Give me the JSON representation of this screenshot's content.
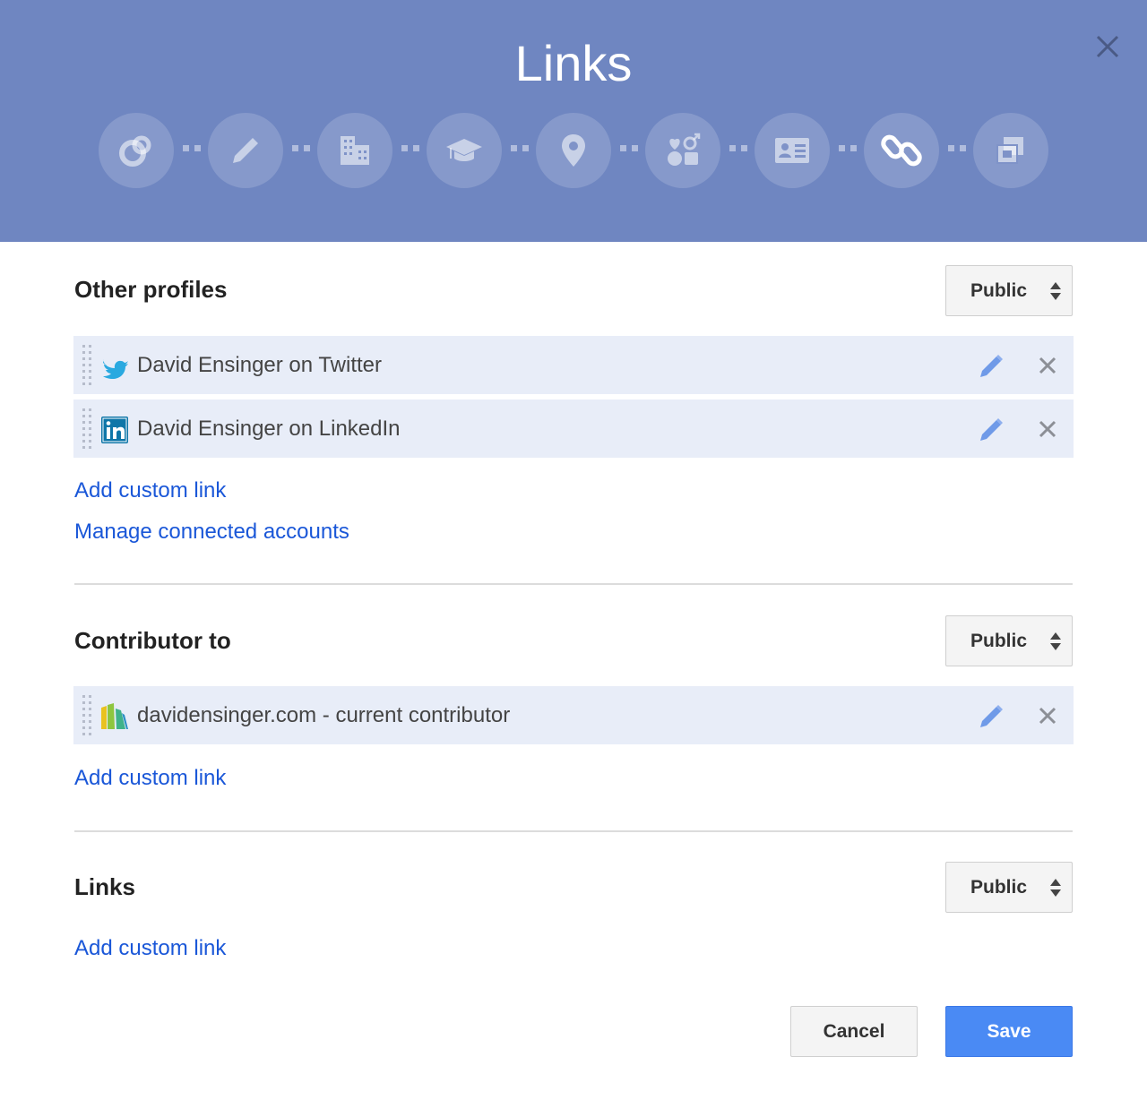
{
  "dialog": {
    "title": "Links",
    "close_icon": "close-icon",
    "steps": [
      {
        "name": "profile-step",
        "icon": "google-plus-ring-icon",
        "active": false
      },
      {
        "name": "about-step",
        "icon": "pencil-icon",
        "active": false
      },
      {
        "name": "work-step",
        "icon": "building-icon",
        "active": false
      },
      {
        "name": "education-step",
        "icon": "graduation-cap-icon",
        "active": false
      },
      {
        "name": "places-step",
        "icon": "map-pin-icon",
        "active": false
      },
      {
        "name": "basic-info-step",
        "icon": "gender-shapes-icon",
        "active": false
      },
      {
        "name": "contact-step",
        "icon": "contact-card-icon",
        "active": false
      },
      {
        "name": "links-step",
        "icon": "chain-link-icon",
        "active": true
      },
      {
        "name": "more-step",
        "icon": "stacked-windows-icon",
        "active": false
      }
    ]
  },
  "other_profiles": {
    "title": "Other profiles",
    "visibility": "Public",
    "items": [
      {
        "label": "David Ensinger on Twitter",
        "icon": "twitter-icon"
      },
      {
        "label": "David Ensinger on LinkedIn",
        "icon": "linkedin-icon"
      }
    ],
    "add_link": "Add custom link",
    "manage_link": "Manage connected accounts"
  },
  "contributor_to": {
    "title": "Contributor to",
    "visibility": "Public",
    "items": [
      {
        "label": "davidensinger.com - current contributor",
        "icon": "site-favicon-icon"
      }
    ],
    "add_link": "Add custom link"
  },
  "links": {
    "title": "Links",
    "visibility": "Public",
    "add_link": "Add custom link"
  },
  "footer": {
    "cancel_label": "Cancel",
    "save_label": "Save"
  },
  "colors": {
    "header_bg": "#6f86c1",
    "row_bg": "#e8edf8",
    "link": "#1a57d8",
    "save_bg": "#4a8af4",
    "edit_icon": "#6f9ae8",
    "twitter": "#2aa9e0",
    "linkedin": "#0e76a8"
  }
}
